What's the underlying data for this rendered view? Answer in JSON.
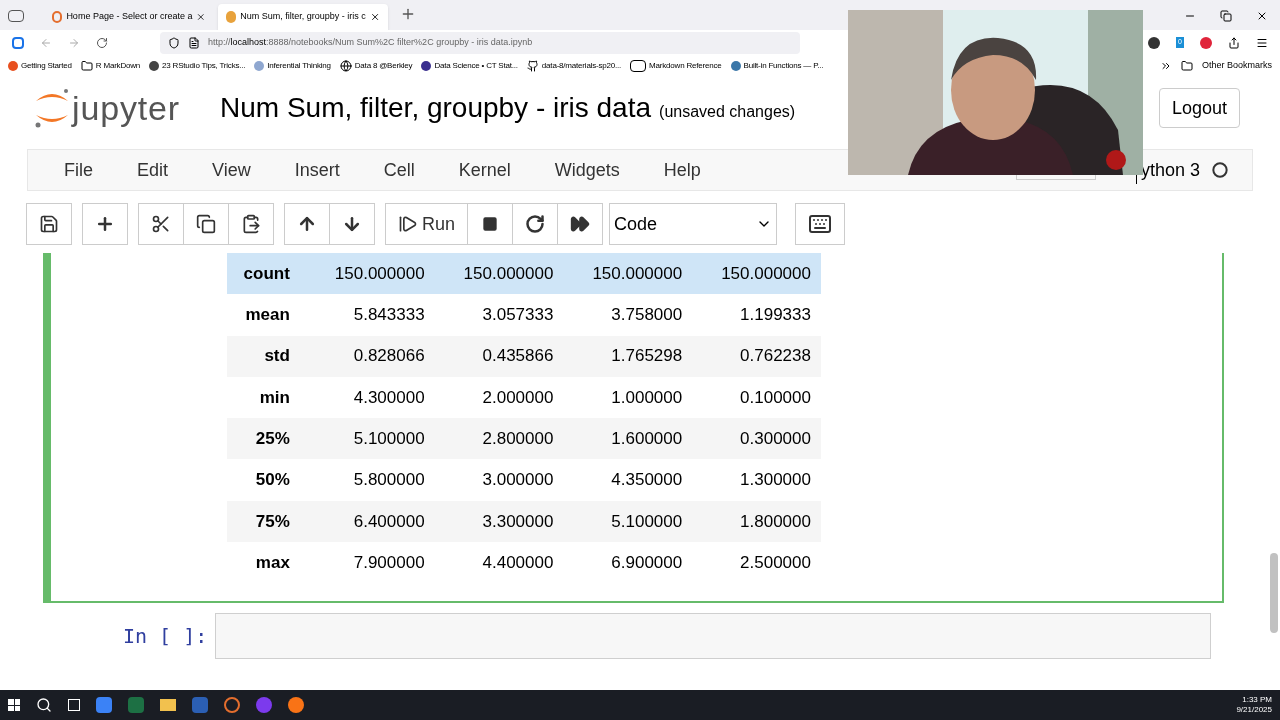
{
  "browser": {
    "tabs": [
      {
        "title": "Home Page - Select or create a",
        "selected": false
      },
      {
        "title": "Num Sum, filter, groupby - iris c",
        "selected": true
      }
    ],
    "address": {
      "prefix": "http://",
      "host": "localhost",
      "rest": ":8888/notebooks/Num Sum%2C filter%2C groupby - iris data.ipynb"
    },
    "bookmarks": [
      {
        "label": "Getting Started",
        "kind": "dot",
        "color": "#e8501f"
      },
      {
        "label": "R MarkDown",
        "kind": "folder"
      },
      {
        "label": "23 RStudio Tips, Tricks...",
        "kind": "dot",
        "color": "#444444"
      },
      {
        "label": "Inferential Thinking",
        "kind": "dot",
        "color": "#8fa7d0"
      },
      {
        "label": "Data 8 @Berkley",
        "kind": "globe"
      },
      {
        "label": "Data Science • CT Stat...",
        "kind": "dot",
        "color": "#3a2f8f"
      },
      {
        "label": "data-8/materials-sp20...",
        "kind": "github"
      },
      {
        "label": "Markdown Reference",
        "kind": "md"
      },
      {
        "label": "Built-in Functions — P...",
        "kind": "dot",
        "color": "#3b77a8"
      }
    ],
    "other_bookmarks": "Other Bookmarks",
    "extension_badge": "0"
  },
  "notebook": {
    "wordmark": "jupyter",
    "title": "Num Sum, filter, groupby - iris data",
    "status": "(unsaved changes)",
    "logout": "Logout",
    "menu": [
      "File",
      "Edit",
      "View",
      "Insert",
      "Cell",
      "Kernel",
      "Widgets",
      "Help"
    ],
    "kernel": "ython 3",
    "run_label": "Run",
    "cell_type": "Code",
    "table": {
      "rows": [
        {
          "label": "count",
          "selected": true,
          "cells": [
            "150.000000",
            "150.000000",
            "150.000000",
            "150.000000"
          ]
        },
        {
          "label": "mean",
          "selected": false,
          "cells": [
            "5.843333",
            "3.057333",
            "3.758000",
            "1.199333"
          ]
        },
        {
          "label": "std",
          "selected": false,
          "cells": [
            "0.828066",
            "0.435866",
            "1.765298",
            "0.762238"
          ]
        },
        {
          "label": "min",
          "selected": false,
          "cells": [
            "4.300000",
            "2.000000",
            "1.000000",
            "0.100000"
          ]
        },
        {
          "label": "25%",
          "selected": false,
          "cells": [
            "5.100000",
            "2.800000",
            "1.600000",
            "0.300000"
          ]
        },
        {
          "label": "50%",
          "selected": false,
          "cells": [
            "5.800000",
            "3.000000",
            "4.350000",
            "1.300000"
          ]
        },
        {
          "label": "75%",
          "selected": false,
          "cells": [
            "6.400000",
            "3.300000",
            "5.100000",
            "1.800000"
          ]
        },
        {
          "label": "max",
          "selected": false,
          "cells": [
            "7.900000",
            "4.400000",
            "6.900000",
            "2.500000"
          ]
        }
      ]
    },
    "next_prompt": "In [ ]:"
  },
  "taskbar": {
    "time": "1:33 PM",
    "date": "9/21/2025"
  }
}
